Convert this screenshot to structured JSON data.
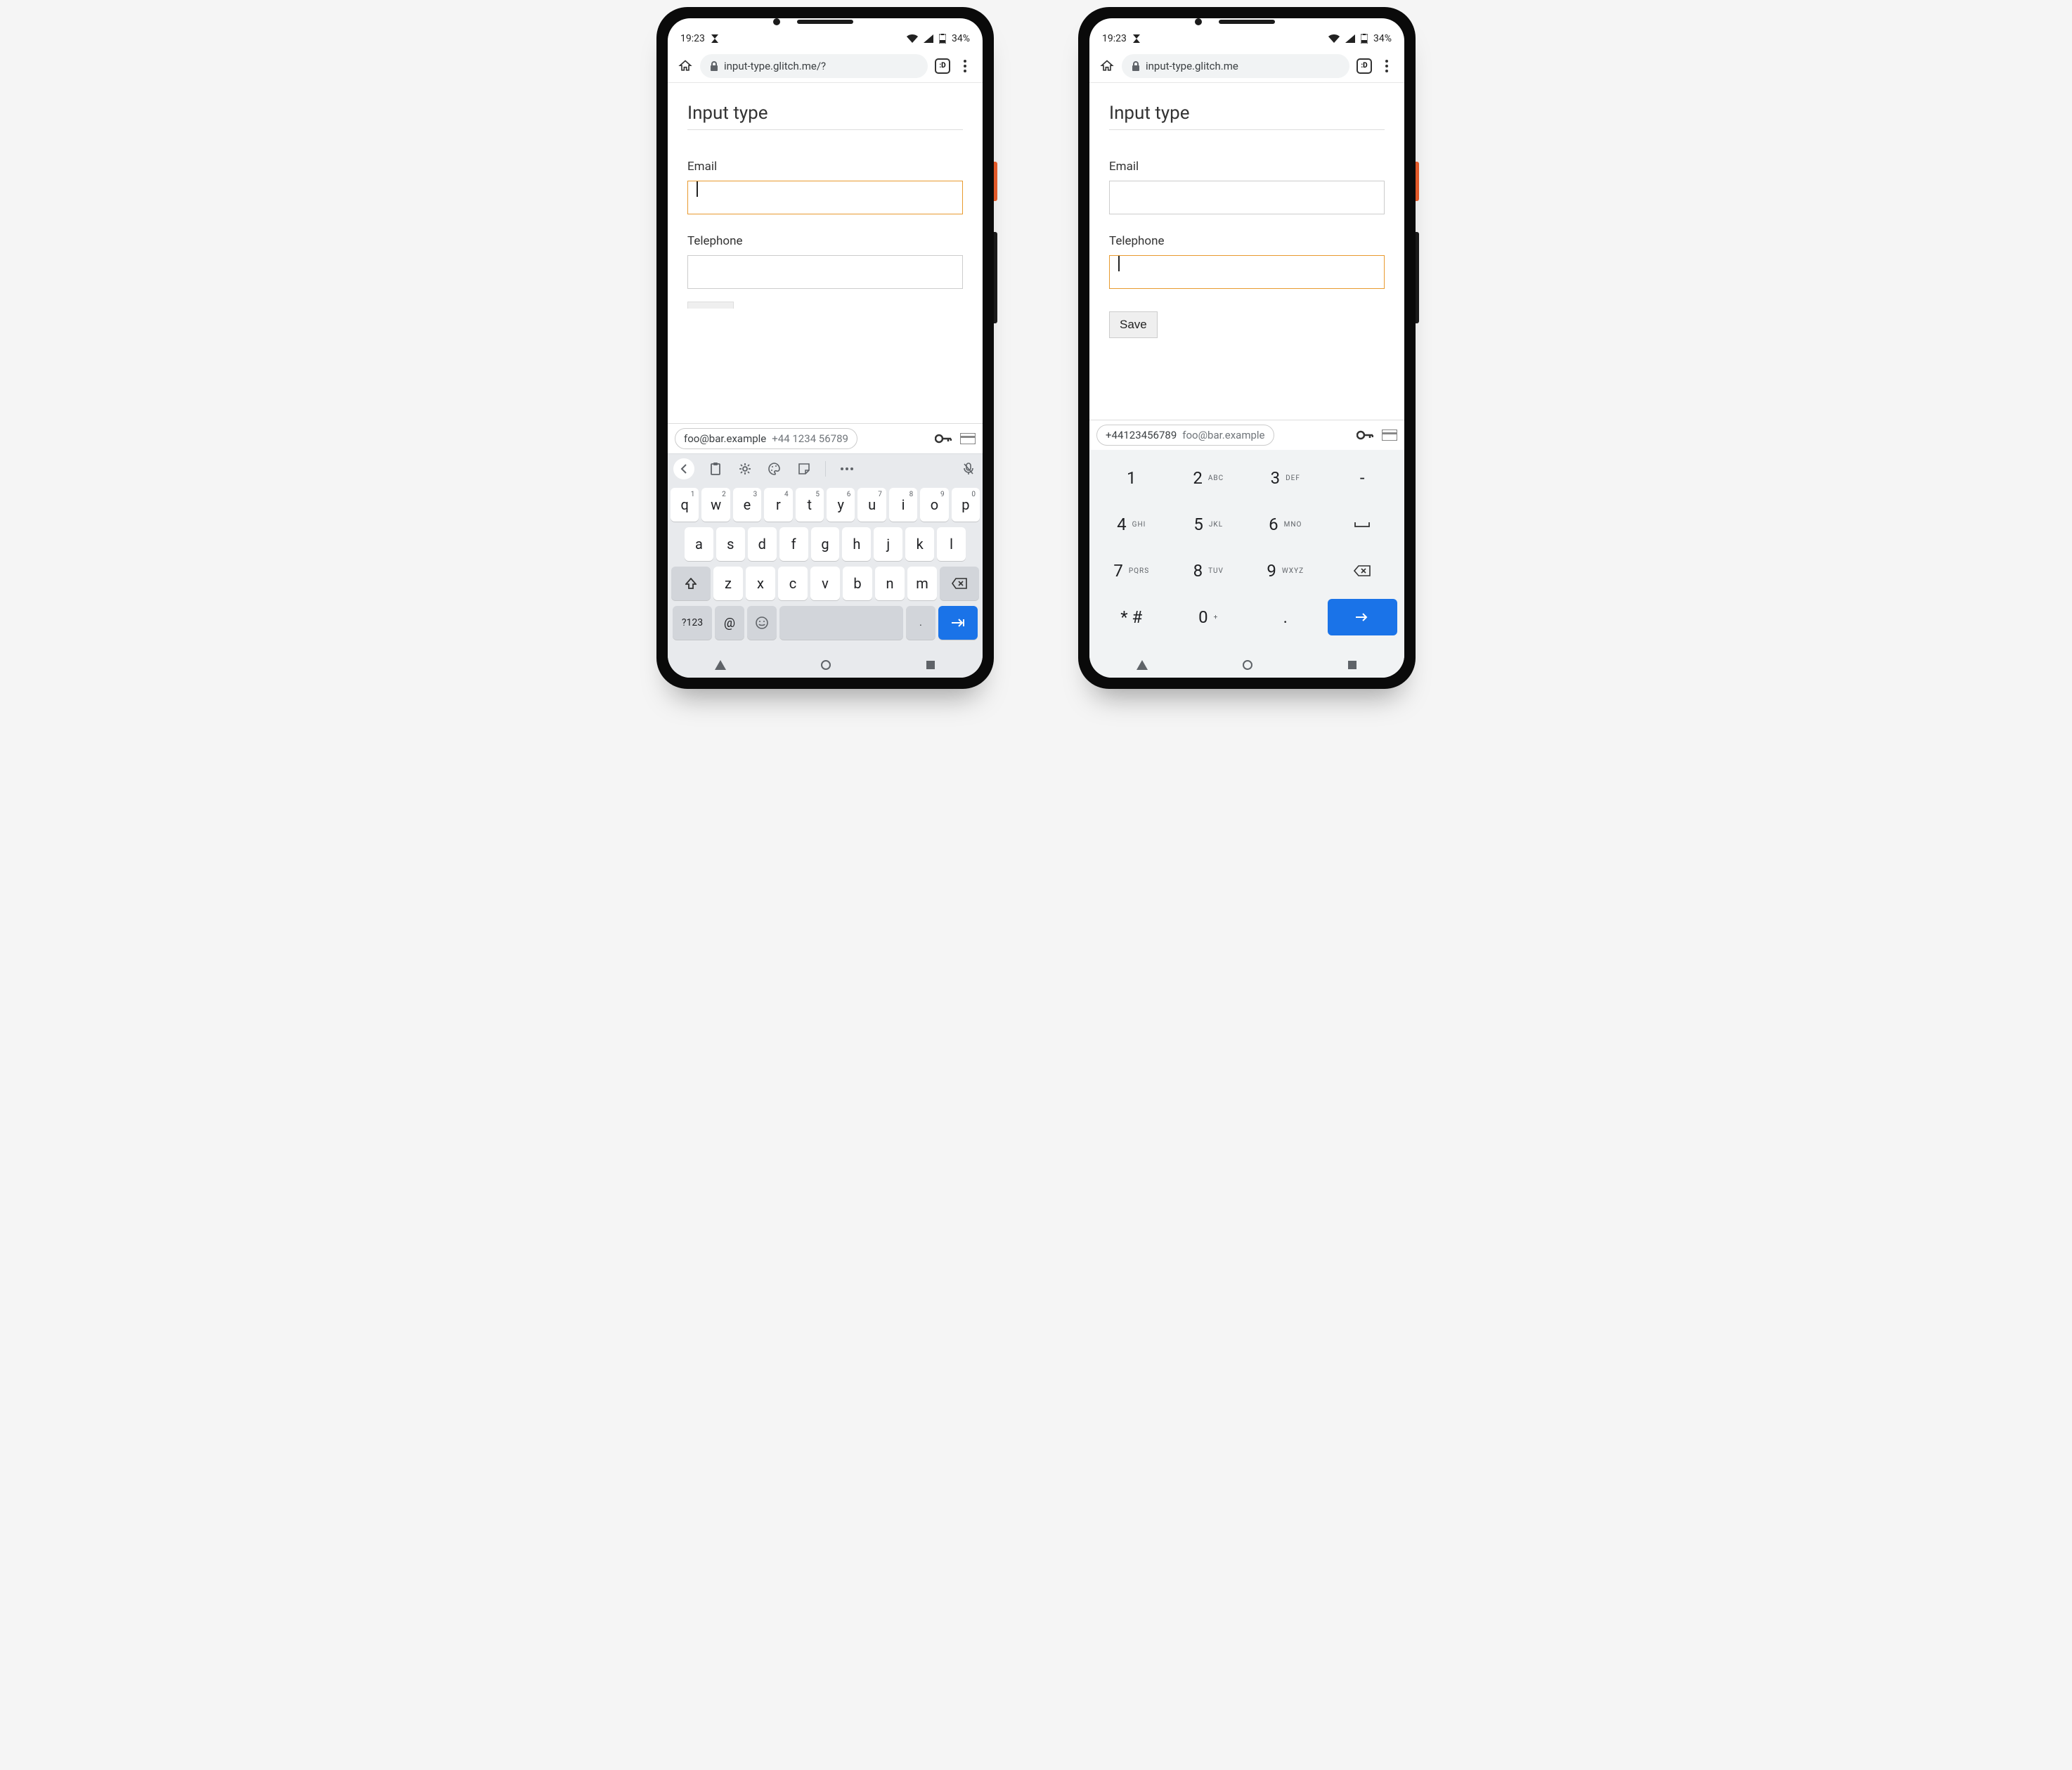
{
  "status": {
    "time": "19:23",
    "battery": "34%"
  },
  "chrome": {
    "tab_count": ":D",
    "url_left": "input-type.glitch.me/?",
    "url_right": "input-type.glitch.me"
  },
  "page": {
    "heading": "Input type",
    "email_label": "Email",
    "telephone_label": "Telephone",
    "save_label": "Save"
  },
  "autofill": {
    "left_primary": "foo@bar.example",
    "left_secondary": "+44 1234 56789",
    "right_primary": "+44123456789",
    "right_secondary": "foo@bar.example"
  },
  "qwerty": {
    "row1": [
      {
        "k": "q",
        "s": "1"
      },
      {
        "k": "w",
        "s": "2"
      },
      {
        "k": "e",
        "s": "3"
      },
      {
        "k": "r",
        "s": "4"
      },
      {
        "k": "t",
        "s": "5"
      },
      {
        "k": "y",
        "s": "6"
      },
      {
        "k": "u",
        "s": "7"
      },
      {
        "k": "i",
        "s": "8"
      },
      {
        "k": "o",
        "s": "9"
      },
      {
        "k": "p",
        "s": "0"
      }
    ],
    "row2": [
      "a",
      "s",
      "d",
      "f",
      "g",
      "h",
      "j",
      "k",
      "l"
    ],
    "row3": [
      "z",
      "x",
      "c",
      "v",
      "b",
      "n",
      "m"
    ],
    "sym": "?123",
    "at": "@",
    "period": "."
  },
  "numpad": {
    "rows": [
      [
        {
          "k": "1"
        },
        {
          "k": "2",
          "s": "ABC"
        },
        {
          "k": "3",
          "s": "DEF"
        },
        {
          "k": "-"
        }
      ],
      [
        {
          "k": "4",
          "s": "GHI"
        },
        {
          "k": "5",
          "s": "JKL"
        },
        {
          "k": "6",
          "s": "MNO"
        },
        {
          "k": "␣"
        }
      ],
      [
        {
          "k": "7",
          "s": "PQRS"
        },
        {
          "k": "8",
          "s": "TUV"
        },
        {
          "k": "9",
          "s": "WXYZ"
        },
        {
          "k": "⌫"
        }
      ],
      [
        {
          "k": "* #"
        },
        {
          "k": "0",
          "s": "+"
        },
        {
          "k": "."
        },
        {
          "k": "→",
          "enter": true
        }
      ]
    ]
  }
}
